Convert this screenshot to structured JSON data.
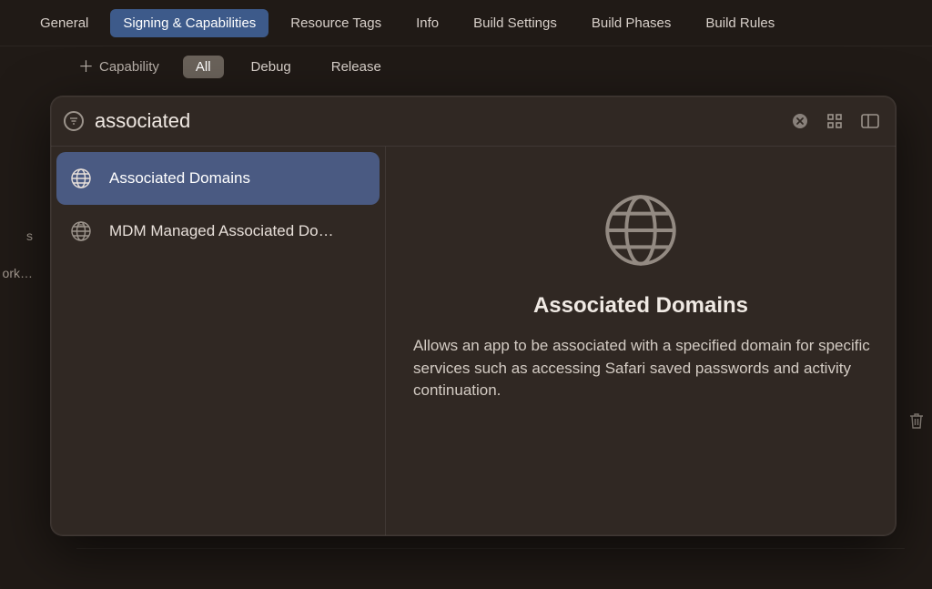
{
  "tabs": {
    "items": [
      "General",
      "Signing & Capabilities",
      "Resource Tags",
      "Info",
      "Build Settings",
      "Build Phases",
      "Build Rules"
    ],
    "active_index": 1
  },
  "cap_bar": {
    "add_label": "Capability",
    "filters": [
      "All",
      "Debug",
      "Release"
    ],
    "active_filter": 0
  },
  "left_fragments": [
    "s",
    "ork…"
  ],
  "panel": {
    "search_value": "associated",
    "results": [
      {
        "label": "Associated Domains",
        "icon": "globe-icon"
      },
      {
        "label": "MDM Managed Associated Do…",
        "icon": "mdm-globe-icon"
      }
    ],
    "selected_result": 0,
    "detail": {
      "title": "Associated Domains",
      "body": "Allows an app to be associated with a specified domain for specific services such as accessing Safari saved passwords and activity continuation."
    }
  }
}
